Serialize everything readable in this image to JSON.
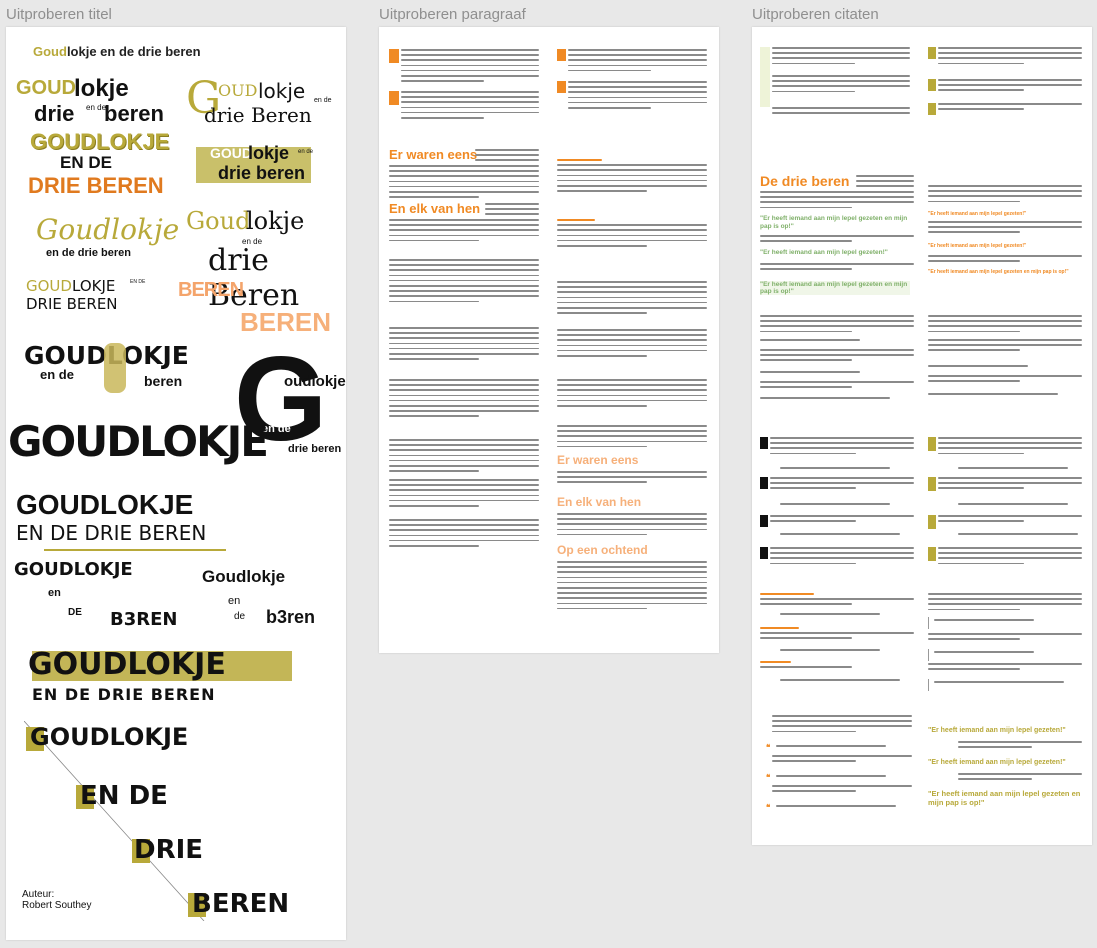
{
  "boards": {
    "titles": {
      "label": "Uitproberen titel"
    },
    "paragraph": {
      "label": "Uitproberen paragraaf"
    },
    "quotes": {
      "label": "Uitproberen citaten"
    }
  },
  "colors": {
    "olive": "#b8a93a",
    "orange": "#f08a24",
    "black": "#111111",
    "green": "#7fb069",
    "grey": "#bdbdbd"
  },
  "title_variants": {
    "v1_part1": "Goud",
    "v1_part2": "lokje en de drie beren",
    "v2_line1a": "GOUD",
    "v2_line1b": "lokje",
    "v2_line2a": "drie",
    "v2_small": "en de",
    "v2_line2b": "beren",
    "v3_G": "G",
    "v3_oud": "OUD",
    "v3_lokje": "lokje",
    "v3_small": "en de",
    "v3_line2": "drie Beren",
    "v4_line1": "GOUDLOKJE",
    "v4_line2": "EN DE",
    "v4_line3": "DRIE BEREN",
    "v5_line1a": "GOUD",
    "v5_line1b": "lokje",
    "v5_line2": "drie beren",
    "v5_small": "en de",
    "v6_line1": "Goudlokje",
    "v6_line2": "en de drie beren",
    "v7_line1a": "Goud",
    "v7_line1b": "lokje",
    "v7_small": "en de",
    "v7_line2": "drie Beren",
    "v8_line1a": "GOUD",
    "v8_line1b": "LOKJE",
    "v8_small": "EN DE",
    "v8_line2": "DRIE BEREN",
    "v9_line1": "BEREN",
    "v9_line2": "BEREN",
    "v10_line1": "GOUDLOKJE",
    "v10_small": "en de",
    "v10_line2": "beren",
    "v11_G": "G",
    "v11_line1": "oudlokje",
    "v11_small": "en de",
    "v11_line2": "drie beren",
    "v12_line1": "GOUDLOKJE",
    "v13_line1": "GOUDLOKJE",
    "v13_line2": "EN DE DRIE BEREN",
    "v14_line1": "GOUDLOKJE",
    "v14_small": "en",
    "v14_small2": "DE",
    "v14_line2": "B3REN",
    "v15_line1": "Goudlokje",
    "v15_small": "en",
    "v15_small2": "de",
    "v15_line2": "b3ren",
    "v16_line1": "GOUDLOKJE",
    "v16_line2": "EN DE DRIE BEREN",
    "v17_line1": "GOUDLOKJE",
    "v17_line2": "EN DE",
    "v17_line3": "DRIE",
    "v17_line4": "BEREN",
    "author_label": "Auteur:",
    "author_name": "Robert Southey"
  },
  "paragraph_board": {
    "heading1": "Er waren eens",
    "heading2": "En elk van hen",
    "heading3": "Er waren eens",
    "heading4": "En elk van hen",
    "heading5": "Op een ochtend"
  },
  "quotes_board": {
    "heading": "De drie beren",
    "quote1": "\"Er heeft iemand aan mijn lepel gezeten en mijn pap is op!\"",
    "quote2": "\"Er heeft iemand aan mijn lepel gezeten!\"",
    "quote3": "\"Er heeft iemand aan mijn lepel gezeten en mijn pap is op!\"",
    "quote4": "\"Er heeft iemand aan mijn lepel gezeten!\"",
    "quote5": "\"Er heeft iemand aan mijn lepel gezeten en mijn pap is op!\"",
    "quote_big1": "\"Er heeft iemand aan mijn lepel gezeten!\"",
    "quote_big2": "\"Er heeft iemand aan mijn lepel gezeten en mijn pap is op!\""
  }
}
